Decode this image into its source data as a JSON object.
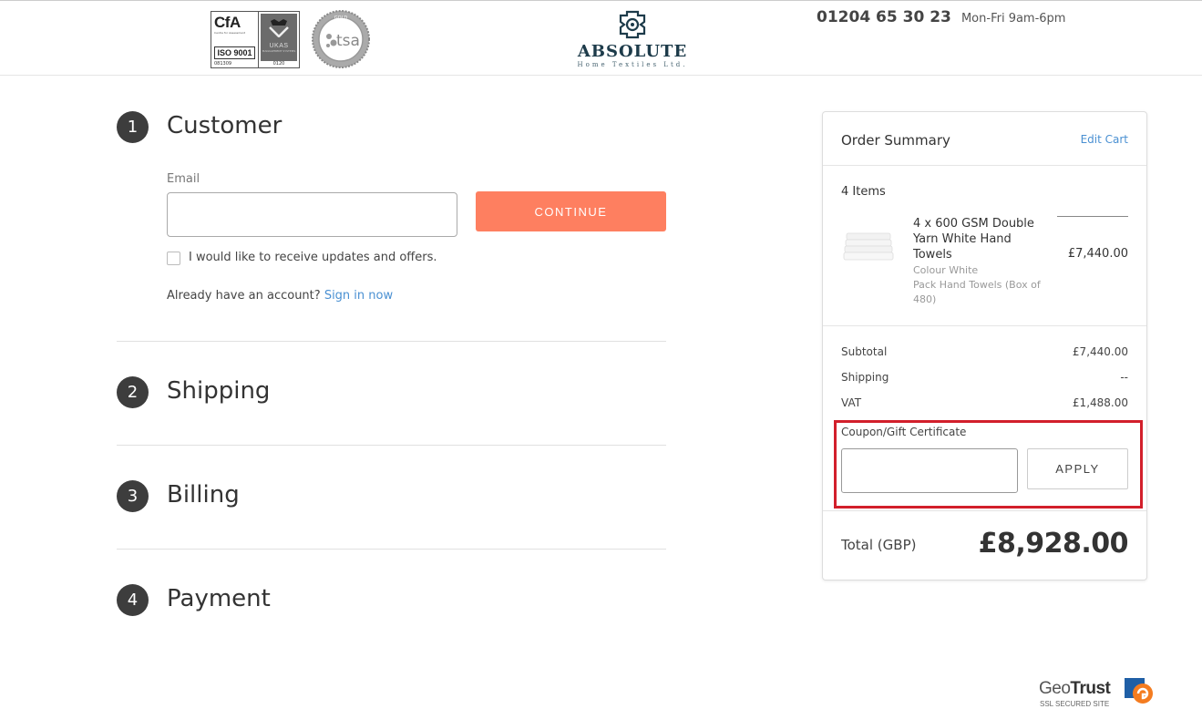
{
  "header": {
    "cert": {
      "cfa": "CfA",
      "cfa_sub": "Centre for Assessment",
      "iso": "ISO 9001",
      "cert_num_left": "081309",
      "ukas": "UKAS",
      "ukas_sub": "MANAGEMENT SYSTEMS",
      "cert_num_right": "0120"
    },
    "tsa": {
      "text": "tsa",
      "gold": "GOLD"
    },
    "logo": {
      "name": "ABSOLUTE",
      "sub": "Home Textiles Ltd."
    },
    "phone": "01204 65 30 23",
    "hours": "Mon-Fri 9am-6pm"
  },
  "steps": [
    {
      "number": "1",
      "title": "Customer"
    },
    {
      "number": "2",
      "title": "Shipping"
    },
    {
      "number": "3",
      "title": "Billing"
    },
    {
      "number": "4",
      "title": "Payment"
    }
  ],
  "customer": {
    "email_label": "Email",
    "email_value": "",
    "continue_label": "CONTINUE",
    "newsletter_label": "I would like to receive updates and offers.",
    "newsletter_checked": false,
    "account_prompt": "Already have an account?",
    "signin_label": "Sign in now"
  },
  "summary": {
    "title": "Order Summary",
    "edit_cart": "Edit Cart",
    "item_count": "4 Items",
    "item": {
      "name": "4 x 600 GSM Double Yarn White Hand Towels",
      "price": "£7,440.00",
      "option_colour": "Colour White",
      "option_pack": "Pack Hand Towels (Box of 480)"
    },
    "subtotal_label": "Subtotal",
    "subtotal_value": "£7,440.00",
    "shipping_label": "Shipping",
    "shipping_value": "--",
    "vat_label": "VAT",
    "vat_value": "£1,488.00",
    "coupon_label": "Coupon/Gift Certificate",
    "coupon_value": "",
    "apply_label": "APPLY",
    "total_label": "Total (GBP)",
    "total_value": "£8,928.00"
  },
  "footer": {
    "geotrust_geo": "Geo",
    "geotrust_trust": "Trust",
    "geotrust_sub": "SSL SECURED SITE"
  },
  "colors": {
    "continue_button": "#fe7f60",
    "link": "#4a90d2",
    "highlight_border": "#d21f2b",
    "step_circle": "#3d3d3d",
    "logo_navy": "#1d3b4a"
  }
}
